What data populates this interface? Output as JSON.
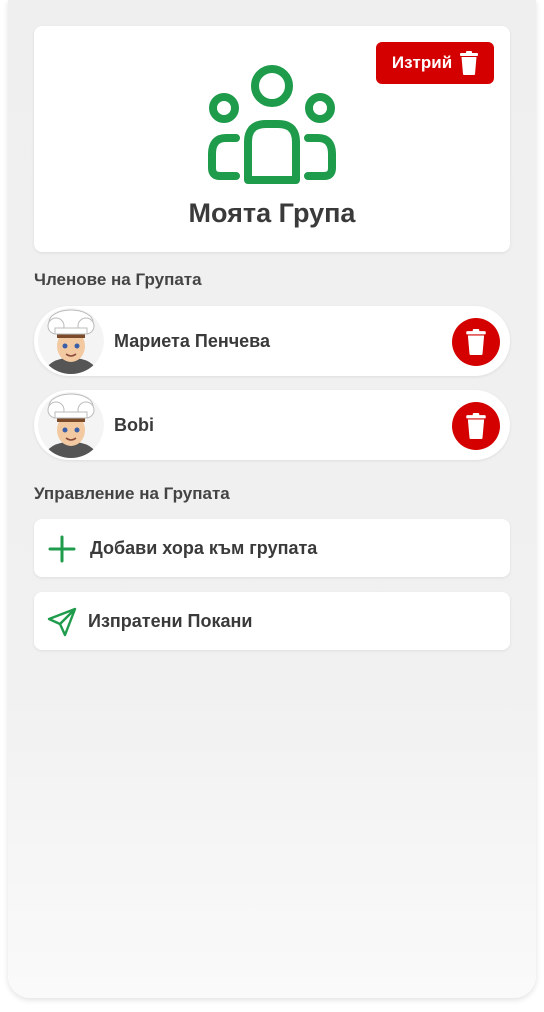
{
  "group": {
    "title": "Моята Група",
    "delete_label": "Изтрий"
  },
  "members_section": {
    "title": "Членове на Групата",
    "members": [
      {
        "name": "Мариета Пенчева"
      },
      {
        "name": "Bobi"
      }
    ]
  },
  "management_section": {
    "title": "Управление на Групата",
    "add_people_label": "Добави хора към групата",
    "sent_invites_label": "Изпратени Покани"
  },
  "colors": {
    "accent_green": "#1e9b4b",
    "danger_red": "#d40000"
  },
  "icons": [
    "group-icon",
    "trash-icon",
    "plus-icon",
    "send-icon",
    "avatar"
  ]
}
